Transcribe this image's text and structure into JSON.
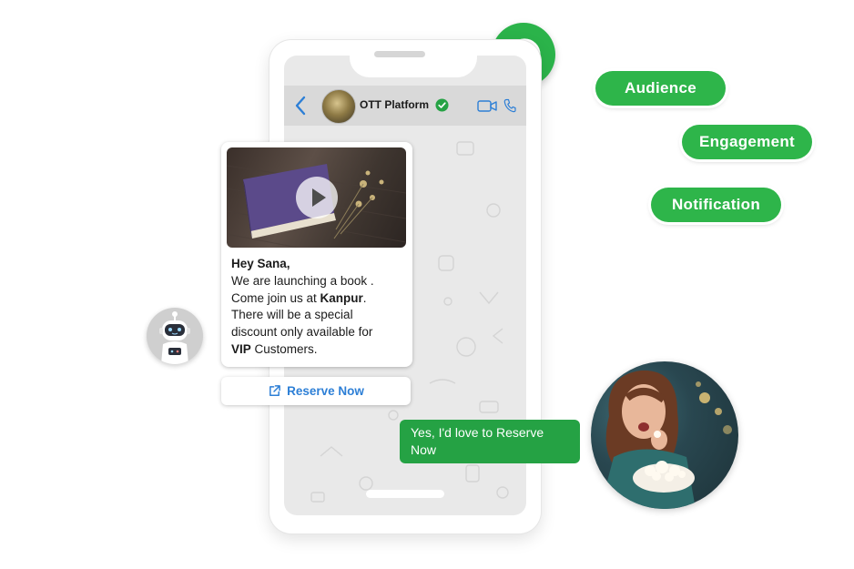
{
  "chat": {
    "contact_name": "OTT Platform",
    "message": {
      "greeting": "Hey Sana,",
      "line1": "We are launching a book .",
      "line2_prefix": "Come join us at ",
      "line2_bold": "Kanpur",
      "line2_suffix": ".",
      "line3": "There will be a special",
      "line4": "discount only available for",
      "line5_bold": "VIP",
      "line5_suffix": " Customers."
    },
    "cta_label": "Reserve Now",
    "reply": "Yes, I'd love to Reserve Now"
  },
  "tags": [
    "Audience",
    "Engagement",
    "Notification"
  ],
  "colors": {
    "whatsapp_green": "#2bb34a",
    "tag_green": "#2eb54a",
    "reply_green": "#25a244",
    "link_blue": "#2d7fd6"
  },
  "icons": [
    "whatsapp-icon",
    "back-arrow-icon",
    "verified-icon",
    "video-call-icon",
    "phone-call-icon",
    "play-icon",
    "external-link-icon",
    "robot-icon"
  ]
}
